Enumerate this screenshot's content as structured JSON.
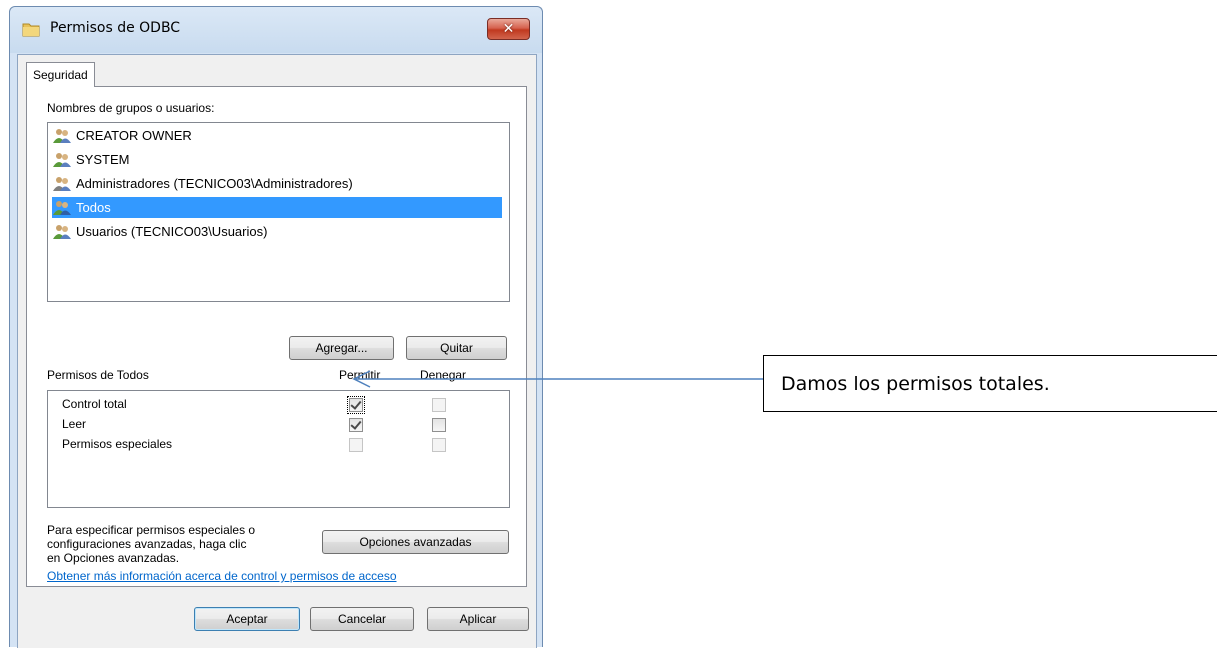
{
  "window": {
    "title": "Permisos de ODBC",
    "close_label": "✕"
  },
  "tabs": [
    {
      "label": "Seguridad"
    }
  ],
  "groups_label": "Nombres de grupos o usuarios:",
  "users": [
    {
      "name": "CREATOR OWNER",
      "selected": false
    },
    {
      "name": "SYSTEM",
      "selected": false
    },
    {
      "name": "Administradores (TECNICO03\\Administradores)",
      "selected": false
    },
    {
      "name": "Todos",
      "selected": true
    },
    {
      "name": "Usuarios (TECNICO03\\Usuarios)",
      "selected": false
    }
  ],
  "buttons": {
    "add": "Agregar...",
    "remove": "Quitar",
    "advanced": "Opciones avanzadas",
    "ok": "Aceptar",
    "cancel": "Cancelar",
    "apply": "Aplicar"
  },
  "permissions": {
    "title": "Permisos de Todos",
    "allow_header": "Permitir",
    "deny_header": "Denegar",
    "rows": [
      {
        "name": "Control total",
        "allow": true,
        "deny": false,
        "enabled": true
      },
      {
        "name": "Leer",
        "allow": true,
        "deny": false,
        "enabled": true
      },
      {
        "name": "Permisos especiales",
        "allow": false,
        "deny": false,
        "enabled": false
      }
    ]
  },
  "advanced_help": {
    "line1": "Para especificar permisos especiales o",
    "line2": "configuraciones avanzadas, haga clic",
    "line3": "en Opciones avanzadas."
  },
  "help_link": "Obtener más información acerca de control y permisos de acceso",
  "annotation": {
    "text": "Damos los permisos totales."
  },
  "colors": {
    "selection": "#3399ff",
    "link": "#0066cc",
    "arrow": "#4f81bd"
  }
}
